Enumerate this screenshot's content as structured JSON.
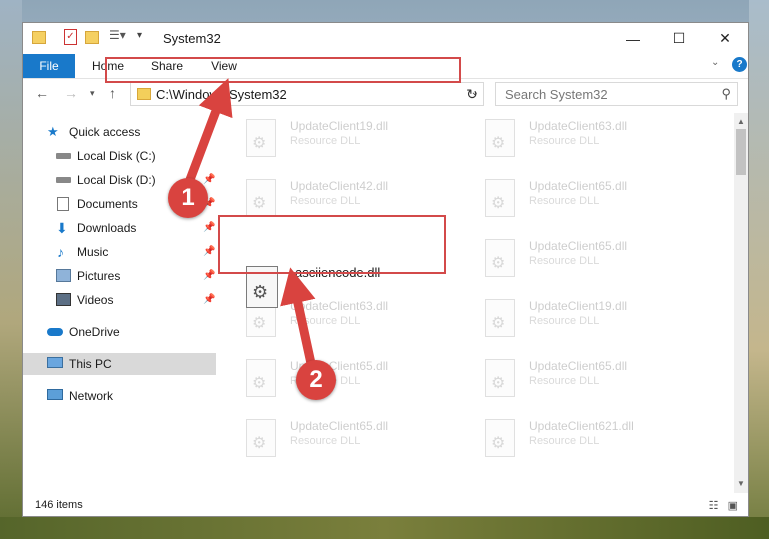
{
  "window": {
    "title": "System32",
    "controls": {
      "minimize": "—",
      "maximize": "☐",
      "close": "✕"
    }
  },
  "ribbon": {
    "tabs": [
      "File",
      "Home",
      "Share",
      "View"
    ],
    "expand_icon": "chevron-down-icon",
    "help_label": "?"
  },
  "navigation": {
    "address": "C:\\Windows\\System32",
    "search_placeholder": "Search System32"
  },
  "sidebar": {
    "items": [
      {
        "label": "Quick access",
        "icon": "star-icon"
      },
      {
        "label": "Local Disk (C:)",
        "icon": "drive-icon"
      },
      {
        "label": "Local Disk (D:)",
        "icon": "drive-icon"
      },
      {
        "label": "Documents",
        "icon": "documents-icon"
      },
      {
        "label": "Downloads",
        "icon": "download-icon"
      },
      {
        "label": "Music",
        "icon": "music-icon"
      },
      {
        "label": "Pictures",
        "icon": "pictures-icon"
      },
      {
        "label": "Videos",
        "icon": "videos-icon"
      },
      {
        "label": "OneDrive",
        "icon": "cloud-icon"
      },
      {
        "label": "This PC",
        "icon": "computer-icon"
      },
      {
        "label": "Network",
        "icon": "network-icon"
      }
    ]
  },
  "files": {
    "faded": [
      {
        "name": "UpdateClient19.dll",
        "type": "Resource DLL"
      },
      {
        "name": "UpdateClient63.dll",
        "type": "Resource DLL"
      },
      {
        "name": "UpdateClient42.dll",
        "type": "Resource DLL"
      },
      {
        "name": "UpdateClient65.dll",
        "type": "Resource DLL"
      },
      {
        "name": "UpdateClient65.dll",
        "type": "Resource DLL"
      },
      {
        "name": "UpdateClient63.dll",
        "type": "Resource DLL"
      },
      {
        "name": "UpdateClient19.dll",
        "type": "Resource DLL"
      },
      {
        "name": "UpdateClient65.dll",
        "type": "Resource DLL"
      },
      {
        "name": "UpdateClient65.dll",
        "type": "Resource DLL"
      },
      {
        "name": "UpdateClient65.dll",
        "type": "Resource DLL"
      },
      {
        "name": "UpdateClient621.dll",
        "type": "Resource DLL"
      }
    ],
    "highlighted": {
      "name": "asciiencode.dll"
    }
  },
  "status": {
    "item_count": "146 items"
  },
  "annotations": {
    "step1": "1",
    "step2": "2",
    "color": "#d9433f"
  }
}
